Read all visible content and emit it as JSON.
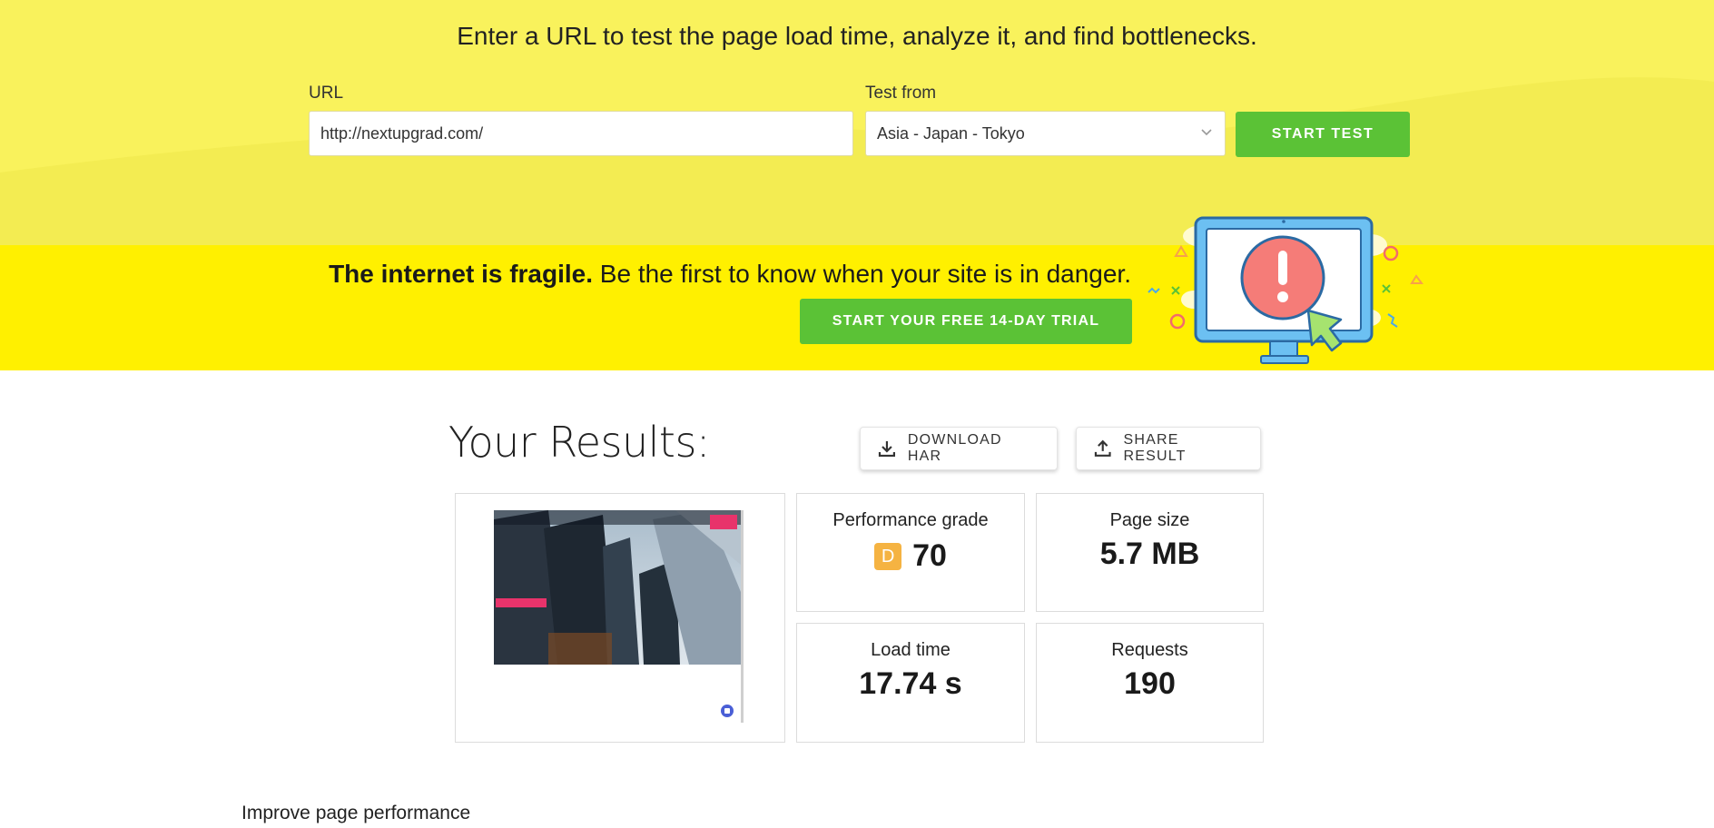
{
  "hero": {
    "title": "Enter a URL to test the page load time, analyze it, and find bottlenecks.",
    "url_label": "URL",
    "url_value": "http://nextupgrad.com/",
    "test_from_label": "Test from",
    "test_from_value": "Asia - Japan - Tokyo",
    "start_button": "START TEST"
  },
  "banner": {
    "headline_bold": "The internet is fragile.",
    "headline_rest": " Be the first to know when your site is in danger.",
    "trial_button": "START YOUR FREE 14-DAY TRIAL"
  },
  "results": {
    "title": "Your Results:",
    "download_button": "DOWNLOAD HAR",
    "share_button": "SHARE RESULT",
    "performance_label": "Performance grade",
    "performance_grade_letter": "D",
    "performance_grade_value": "70",
    "page_size_label": "Page size",
    "page_size_value": "5.7 MB",
    "load_time_label": "Load time",
    "load_time_value": "17.74 s",
    "requests_label": "Requests",
    "requests_value": "190"
  },
  "improve_heading": "Improve page performance",
  "colors": {
    "hero_bg": "#f9f25c",
    "banner_bg": "#fff000",
    "accent_green": "#5bc236",
    "grade_d": "#f5b342"
  }
}
